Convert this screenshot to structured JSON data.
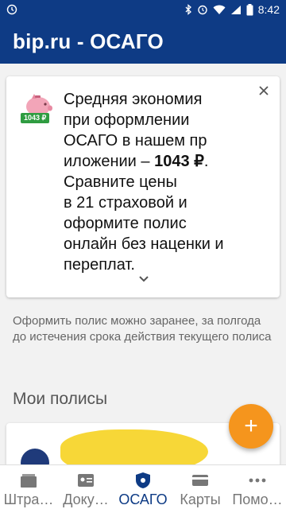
{
  "status_bar": {
    "time": "8:42"
  },
  "app_bar": {
    "title": "bip.ru - ОСАГО"
  },
  "promo": {
    "badge": "1043 ₽",
    "text_before": "Средняя экономия\nпри оформлении\nОСАГО в нашем пр\nиложении – ",
    "amount": "1043 ₽",
    "text_after": ".\nСравните цены\nв 21 страховой и\nоформите полис\nонлайн без наценки и\n переплат."
  },
  "hint": "Оформить полис можно заранее, за полгода до истечения срока действия текущего полиса",
  "section_title": "Мои полисы",
  "fab_label": "+",
  "nav": [
    {
      "label": "Штра…",
      "icon": "wallet-icon"
    },
    {
      "label": "Доку…",
      "icon": "id-card-icon"
    },
    {
      "label": "ОСАГО",
      "icon": "shield-icon"
    },
    {
      "label": "Карты",
      "icon": "card-icon"
    },
    {
      "label": "Помо…",
      "icon": "more-icon"
    }
  ],
  "colors": {
    "primary": "#0e3b85",
    "accent": "#f5951d",
    "badge": "#2f9c41"
  }
}
